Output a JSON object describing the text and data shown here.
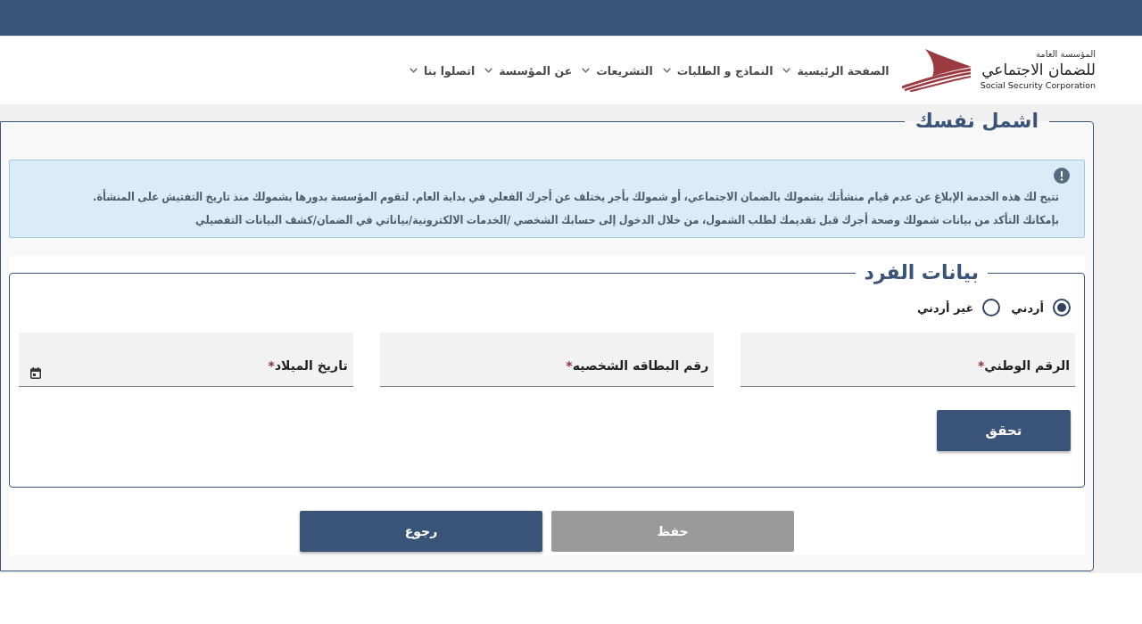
{
  "header": {
    "logo": {
      "line_1": "المؤسسة العامة",
      "line_2": "للضمان الاجتماعي",
      "line_3": "Social Security Corporation"
    },
    "nav": [
      {
        "label": "الصفحة الرئيسية",
        "dropdown": true
      },
      {
        "label": "النماذج و الطلبات",
        "dropdown": true
      },
      {
        "label": "التشريعات",
        "dropdown": true
      },
      {
        "label": "عن المؤسسة",
        "dropdown": true
      },
      {
        "label": "اتصلوا بنا",
        "dropdown": true
      }
    ]
  },
  "section": {
    "title": "اشمل نفسك",
    "notice": {
      "kind": "info",
      "lines": [
        "تتيح لك هذه الخدمة الإبلاغ عن عدم قيام منشأتك بشمولك بالضمان الاجتماعي، أو شمولك بأجر يختلف عن أجرك الفعلي في بداية العام. لتقوم المؤسسة بدورها بشمولك منذ تاريخ التفتيش على المنشأة.",
        "بإمكانك التأكد من بيانات شمولك وصحة أجرك قبل تقديمك لطلب الشمول، من خلال الدخول إلى حسابك الشخصي /الخدمات الالكترونية/بياناتي في الضمان/كشف البيانات التفصيلي"
      ]
    },
    "panel": {
      "title": "بيانات الفرد",
      "nationality": [
        {
          "label": "أردني",
          "selected": true
        },
        {
          "label": "غير أردني",
          "selected": false
        }
      ],
      "fields": [
        {
          "kind": "text",
          "label": "الرقم الوطني",
          "required_mark": "*"
        },
        {
          "kind": "text",
          "label": "رقم البطاقه الشخصيه",
          "required_mark": "*"
        },
        {
          "kind": "date",
          "label": "تاريخ الميلاد",
          "required_mark": "*"
        }
      ],
      "verify_button": {
        "label": "تحقق"
      }
    },
    "actions": [
      {
        "label": "حفظ",
        "disabled": true
      },
      {
        "label": "رجوع",
        "disabled": false
      }
    ]
  }
}
